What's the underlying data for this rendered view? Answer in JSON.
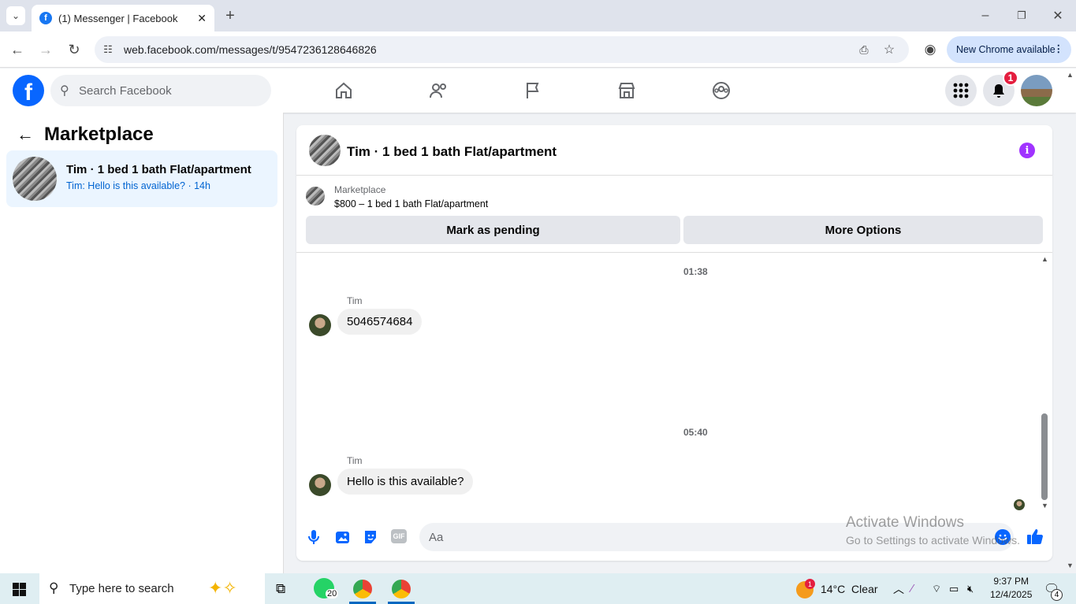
{
  "browser": {
    "tab_title": "(1) Messenger | Facebook",
    "url": "web.facebook.com/messages/t/9547236128646826",
    "new_chrome": "New Chrome available"
  },
  "fb": {
    "search_placeholder": "Search Facebook",
    "notification_count": "1"
  },
  "left": {
    "title": "Marketplace",
    "conversation": {
      "name": "Tim · 1 bed 1 bath Flat/apartment",
      "preview": "Tim: Hello is this available? · 14h"
    }
  },
  "chat": {
    "title": "Tim · 1 bed 1 bath Flat/apartment",
    "listing_source": "Marketplace",
    "listing_desc": "$800 – 1 bed 1 bath Flat/apartment",
    "btn_pending": "Mark as pending",
    "btn_more": "More Options",
    "messages": [
      {
        "time": "01:38",
        "sender": "Tim",
        "text": "5046574684"
      },
      {
        "time": "05:40",
        "sender": "Tim",
        "text": "Hello is this available?"
      }
    ],
    "input_placeholder": "Aa",
    "watermark_title": "Activate Windows",
    "watermark_sub": "Go to Settings to activate Windows."
  },
  "taskbar": {
    "search_placeholder": "Type here to search",
    "whatsapp_badge": "20",
    "weather": "14°C  Clear",
    "weather_badge": "1",
    "time": "9:37 PM",
    "date": "12/4/2025",
    "notif_count": "4"
  },
  "colors": {
    "fb_blue": "#0866ff",
    "accent_purple": "#a033ff",
    "badge_red": "#e41e3f"
  }
}
